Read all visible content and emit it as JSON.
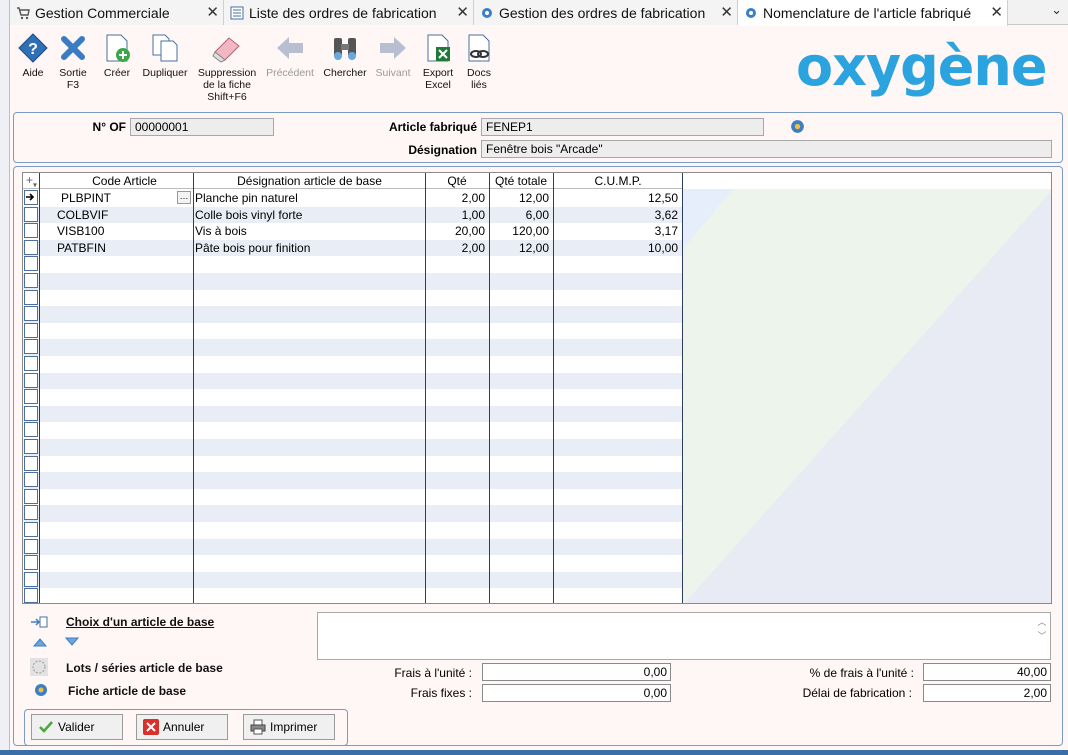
{
  "tabs": [
    {
      "label": "Gestion Commerciale",
      "icon": "cart-icon"
    },
    {
      "label": "Liste des ordres de fabrication",
      "icon": "list-icon"
    },
    {
      "label": "Gestion des ordres de fabrication",
      "icon": "gear-icon"
    },
    {
      "label": "Nomenclature de l'article fabriqué",
      "icon": "gear-icon"
    }
  ],
  "toolbar": {
    "aide": "Aide",
    "sortie": "Sortie",
    "sortie_key": "F3",
    "creer": "Créer",
    "dupliquer": "Dupliquer",
    "suppression": "Suppression",
    "suppression2": "de la fiche",
    "suppression_key": "Shift+F6",
    "precedent": "Précédent",
    "chercher": "Chercher",
    "suivant": "Suivant",
    "export": "Export",
    "export2": "Excel",
    "docs": "Docs",
    "docs2": "liés"
  },
  "logo": "oxygène",
  "header": {
    "of_label": "N° OF",
    "of_value": "00000001",
    "article_label": "Article fabriqué",
    "article_value": "FENEP1",
    "designation_label": "Désignation",
    "designation_value": "Fenêtre bois \"Arcade\""
  },
  "grid": {
    "columns": [
      "Code Article",
      "Désignation article de base",
      "Qté",
      "Qté totale",
      "C.U.M.P."
    ],
    "rows": [
      {
        "code": "PLBPINT",
        "designation": "Planche pin naturel",
        "qte": "2,00",
        "qte_totale": "12,00",
        "cump": "12,50"
      },
      {
        "code": "COLBVIF",
        "designation": "Colle bois vinyl forte",
        "qte": "1,00",
        "qte_totale": "6,00",
        "cump": "3,62"
      },
      {
        "code": "VISB100",
        "designation": "Vis à  bois",
        "qte": "20,00",
        "qte_totale": "120,00",
        "cump": "3,17"
      },
      {
        "code": "PATBFIN",
        "designation": "Pâte bois pour finition",
        "qte": "2,00",
        "qte_totale": "12,00",
        "cump": "10,00"
      }
    ]
  },
  "side": {
    "choix": "Choix d'un article de base",
    "lots": "Lots / séries article de base",
    "fiche": "Fiche article de base"
  },
  "footer": {
    "frais_unite_label": "Frais à l'unité :",
    "frais_unite_value": "0,00",
    "frais_fixes_label": "Frais fixes :",
    "frais_fixes_value": "0,00",
    "pct_frais_label": "% de frais à l'unité :",
    "pct_frais_value": "40,00",
    "delai_label": "Délai de fabrication :",
    "delai_value": "2,00"
  },
  "actions": {
    "valider": "Valider",
    "annuler": "Annuler",
    "imprimer": "Imprimer"
  }
}
